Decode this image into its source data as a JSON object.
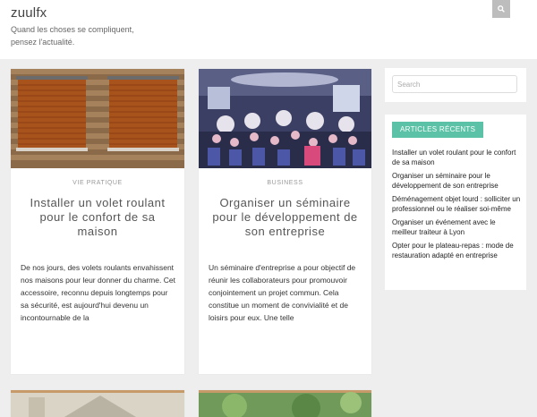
{
  "header": {
    "site_title": "zuulfx",
    "site_description": "Quand les choses se compliquent, pensez l'actualité."
  },
  "search_toggle": {
    "icon": "search-icon"
  },
  "posts": [
    {
      "category": "VIE PRATIQUE",
      "title": "Installer un volet roulant pour le confort de sa maison",
      "excerpt": "De nos jours, des volets roulants envahissent nos maisons pour leur donner du charme. Cet accessoire, reconnu depuis longtemps pour sa sécurité, est aujourd'hui devenu un incontournable de la"
    },
    {
      "category": "BUSINESS",
      "title": "Organiser un séminaire pour le développement de son entreprise",
      "excerpt": "Un séminaire d'entreprise a pour objectif de réunir les collaborateurs pour promouvoir conjointement un projet commun. Cela constitue un moment de convivialité et de loisirs pour eux. Une telle"
    }
  ],
  "sidebar": {
    "search_placeholder": "Search",
    "recent_title": "ARTICLES RÉCENTS",
    "recent": [
      "Installer un volet roulant pour le confort de sa maison",
      "Organiser un séminaire pour le développement de son entreprise",
      "Déménagement objet lourd : solliciter un professionnel ou le réaliser soi-même",
      "Organiser un événement avec le meilleur traiteur à Lyon",
      "Opter pour le plateau-repas : mode de restauration adapté en entreprise"
    ]
  },
  "colors": {
    "accent": "#5bc2a7",
    "background": "#eeeeee"
  }
}
